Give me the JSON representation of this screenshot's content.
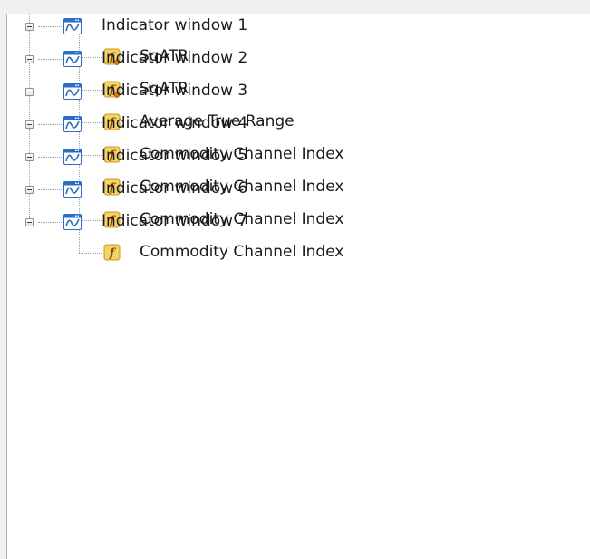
{
  "tree": {
    "windows": [
      {
        "label": "Indicator window 1",
        "child": {
          "label": "SqATR",
          "icon": "custom-function-icon"
        }
      },
      {
        "label": "Indicator window 2",
        "child": {
          "label": "SqATR",
          "icon": "custom-function-icon"
        }
      },
      {
        "label": "Indicator window 3",
        "child": {
          "label": "Average True Range",
          "icon": "function-icon"
        }
      },
      {
        "label": "Indicator window 4",
        "child": {
          "label": "Commodity Channel Index",
          "icon": "function-icon"
        }
      },
      {
        "label": "Indicator window 5",
        "child": {
          "label": "Commodity Channel Index",
          "icon": "function-icon"
        }
      },
      {
        "label": "Indicator window 6",
        "child": {
          "label": "Commodity Channel Index",
          "icon": "function-icon"
        }
      },
      {
        "label": "Indicator window 7",
        "child": {
          "label": "Commodity Channel Index",
          "icon": "function-icon"
        }
      }
    ]
  },
  "colors": {
    "window_icon_blue": "#2b6cc4",
    "function_icon_fill": "#f5d168",
    "function_icon_border": "#c89a1e",
    "custom_mark_orange": "#e07d10"
  }
}
